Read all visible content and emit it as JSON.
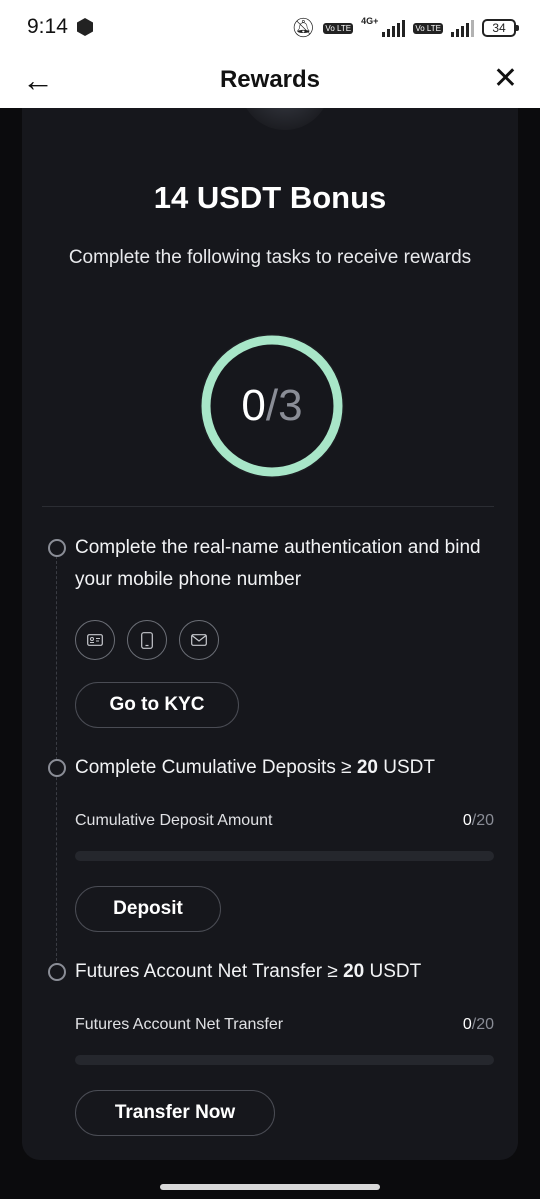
{
  "status_bar": {
    "time": "9:14",
    "network_tag": "4G+",
    "volte_1": "Vo LTE",
    "volte_2": "Vo LTE",
    "battery": "34"
  },
  "header": {
    "title": "Rewards",
    "back_icon": "arrow-left-icon",
    "close_icon": "close-icon"
  },
  "bonus": {
    "title": "14 USDT Bonus",
    "subtitle": "Complete the following tasks to receive rewards",
    "completed": "0",
    "total": "3",
    "ring_color": "#a8e6c8"
  },
  "tasks": [
    {
      "title": "Complete the real-name authentication and bind your mobile phone number",
      "icons": [
        "id-card-icon",
        "phone-icon",
        "mail-icon"
      ],
      "button": "Go to KYC"
    },
    {
      "title_prefix": "Complete Cumulative Deposits ≥ ",
      "title_amount": "20",
      "title_suffix": " USDT",
      "row_label": "Cumulative Deposit Amount",
      "current": "0",
      "max": "20",
      "progress": 0,
      "button": "Deposit"
    },
    {
      "title_prefix": "Futures Account Net Transfer ≥ ",
      "title_amount": "20",
      "title_suffix": " USDT",
      "row_label": "Futures Account Net Transfer",
      "current": "0",
      "max": "20",
      "progress": 0,
      "button": "Transfer Now"
    }
  ],
  "colors": {
    "accent": "#7ee0b2",
    "card_bg": "#16171c",
    "page_bg": "#0b0b0d"
  }
}
